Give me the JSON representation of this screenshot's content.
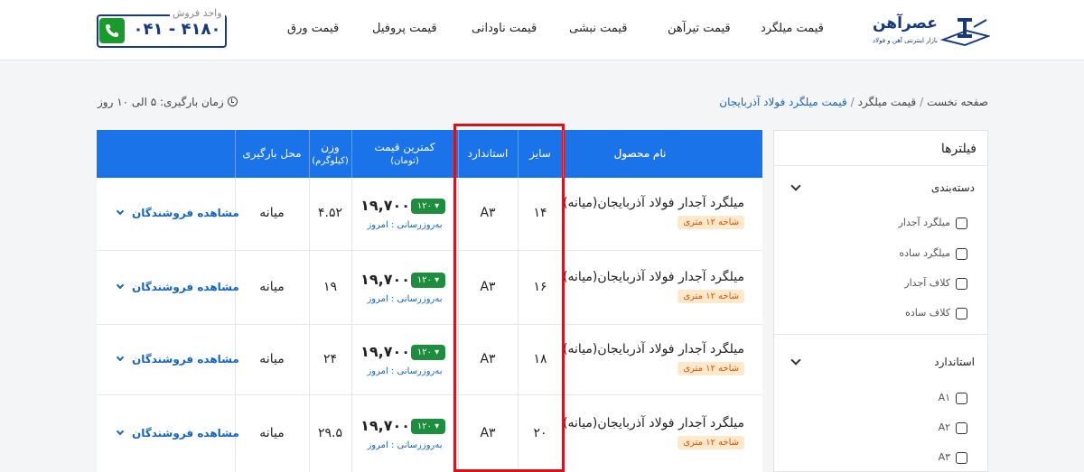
{
  "header": {
    "logo_title": "عصرآهن",
    "logo_subtitle": "بازار اینترنتی آهن و فولاد",
    "nav": [
      "قیمت میلگرد",
      "قیمت تیرآهن",
      "قیمت نبشی",
      "قیمت ناودانی",
      "قیمت پروفیل",
      "قیمت ورق"
    ],
    "sales_label": "واحد فروش",
    "phone": "۰۴۱ - ۴۱۸۰"
  },
  "breadcrumb": {
    "home": "صفحه نخست",
    "category": "قیمت میلگرد",
    "current": "قیمت میلگرد فولاد آذربایجان"
  },
  "lead_time": "زمان بارگیری: ۵ الی ۱۰ روز",
  "filters": {
    "title": "فیلترها",
    "sections": [
      {
        "title": "دسته‌بندی",
        "options": [
          "میلگرد آجدار",
          "میلگرد ساده",
          "کلاف آجدار",
          "کلاف ساده"
        ]
      },
      {
        "title": "استاندارد",
        "options": [
          "A۱",
          "A۲",
          "A۳"
        ]
      }
    ]
  },
  "table": {
    "headers": {
      "name": "نام محصول",
      "size": "سایز",
      "standard": "استاندارد",
      "price": "کمترین قیمت",
      "price_unit": "(تومان)",
      "weight": "وزن",
      "weight_unit": "(کیلوگرم)",
      "location": "محل بارگیری"
    },
    "rows": [
      {
        "name": "میلگرد آجدار فولاد آذربایجان(میانه)",
        "tag": "شاخه ۱۲ متری",
        "size": "۱۴",
        "standard": "A۳",
        "price": "۱۹,۷۰۰",
        "change": "۱۲۰",
        "updated": "به‌روزرسانی : امروز",
        "weight": "۴.۵۲",
        "location": "میانه",
        "sellers": "مشاهده فروشندگان"
      },
      {
        "name": "میلگرد آجدار فولاد آذربایجان(میانه)",
        "tag": "شاخه ۱۲ متری",
        "size": "۱۶",
        "standard": "A۳",
        "price": "۱۹,۷۰۰",
        "change": "۱۲۰",
        "updated": "به‌روزرسانی : امروز",
        "weight": "۱۹",
        "location": "میانه",
        "sellers": "مشاهده فروشندگان"
      },
      {
        "name": "میلگرد آجدار فولاد آذربایجان(میانه)",
        "tag": "شاخه ۱۲ متری",
        "size": "۱۸",
        "standard": "A۳",
        "price": "۱۹,۷۰۰",
        "change": "۱۲۰",
        "updated": "به‌روزرسانی : امروز",
        "weight": "۲۴",
        "location": "میانه",
        "sellers": "مشاهده فروشندگان"
      },
      {
        "name": "میلگرد آجدار فولاد آذربایجان(میانه)",
        "tag": "شاخه ۱۲ متری",
        "size": "۲۰",
        "standard": "A۳",
        "price": "۱۹,۷۰۰",
        "change": "۱۲۰",
        "updated": "به‌روزرسانی : امروز",
        "weight": "۲۹.۵",
        "location": "میانه",
        "sellers": "مشاهده فروشندگان"
      }
    ]
  },
  "colors": {
    "accent": "#1a73e8",
    "brand": "#163a7a",
    "highlight": "#d3141a",
    "up_badge": "#1e8e3e",
    "tag_bg": "#ffe9cc"
  }
}
